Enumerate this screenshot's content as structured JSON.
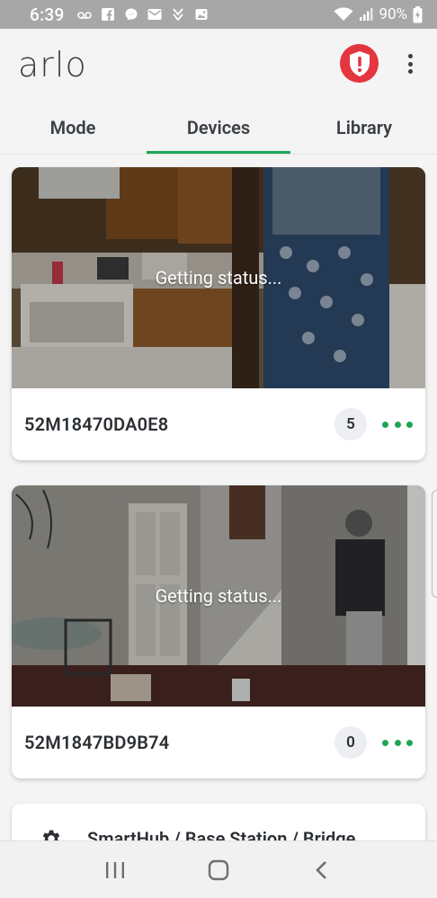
{
  "status_bar": {
    "time": "6:39",
    "battery": "90%",
    "icons": [
      "voicemail-icon",
      "facebook-icon",
      "messenger-icon",
      "mail-icon",
      "download-icon",
      "photo-icon",
      "wifi-icon",
      "signal-icon",
      "battery-icon"
    ]
  },
  "header": {
    "logo": "arlo",
    "alert_icon": "shield-alert-icon",
    "menu_icon": "more-vertical-icon"
  },
  "tabs": [
    {
      "label": "Mode",
      "active": false
    },
    {
      "label": "Devices",
      "active": true
    },
    {
      "label": "Library",
      "active": false
    }
  ],
  "devices": [
    {
      "name": "52M18470DA0E8",
      "status": "Getting status...",
      "count": "5"
    },
    {
      "name": "52M1847BD9B74",
      "status": "Getting status...",
      "count": "0"
    }
  ],
  "hub": {
    "label": "SmartHub / Base Station / Bridge",
    "icon": "gear-icon"
  },
  "nav": [
    "recent-apps-icon",
    "home-icon",
    "back-icon"
  ],
  "colors": {
    "accent": "#1ea653",
    "alert": "#e4363e",
    "status_bar": "#a7a7a7"
  }
}
